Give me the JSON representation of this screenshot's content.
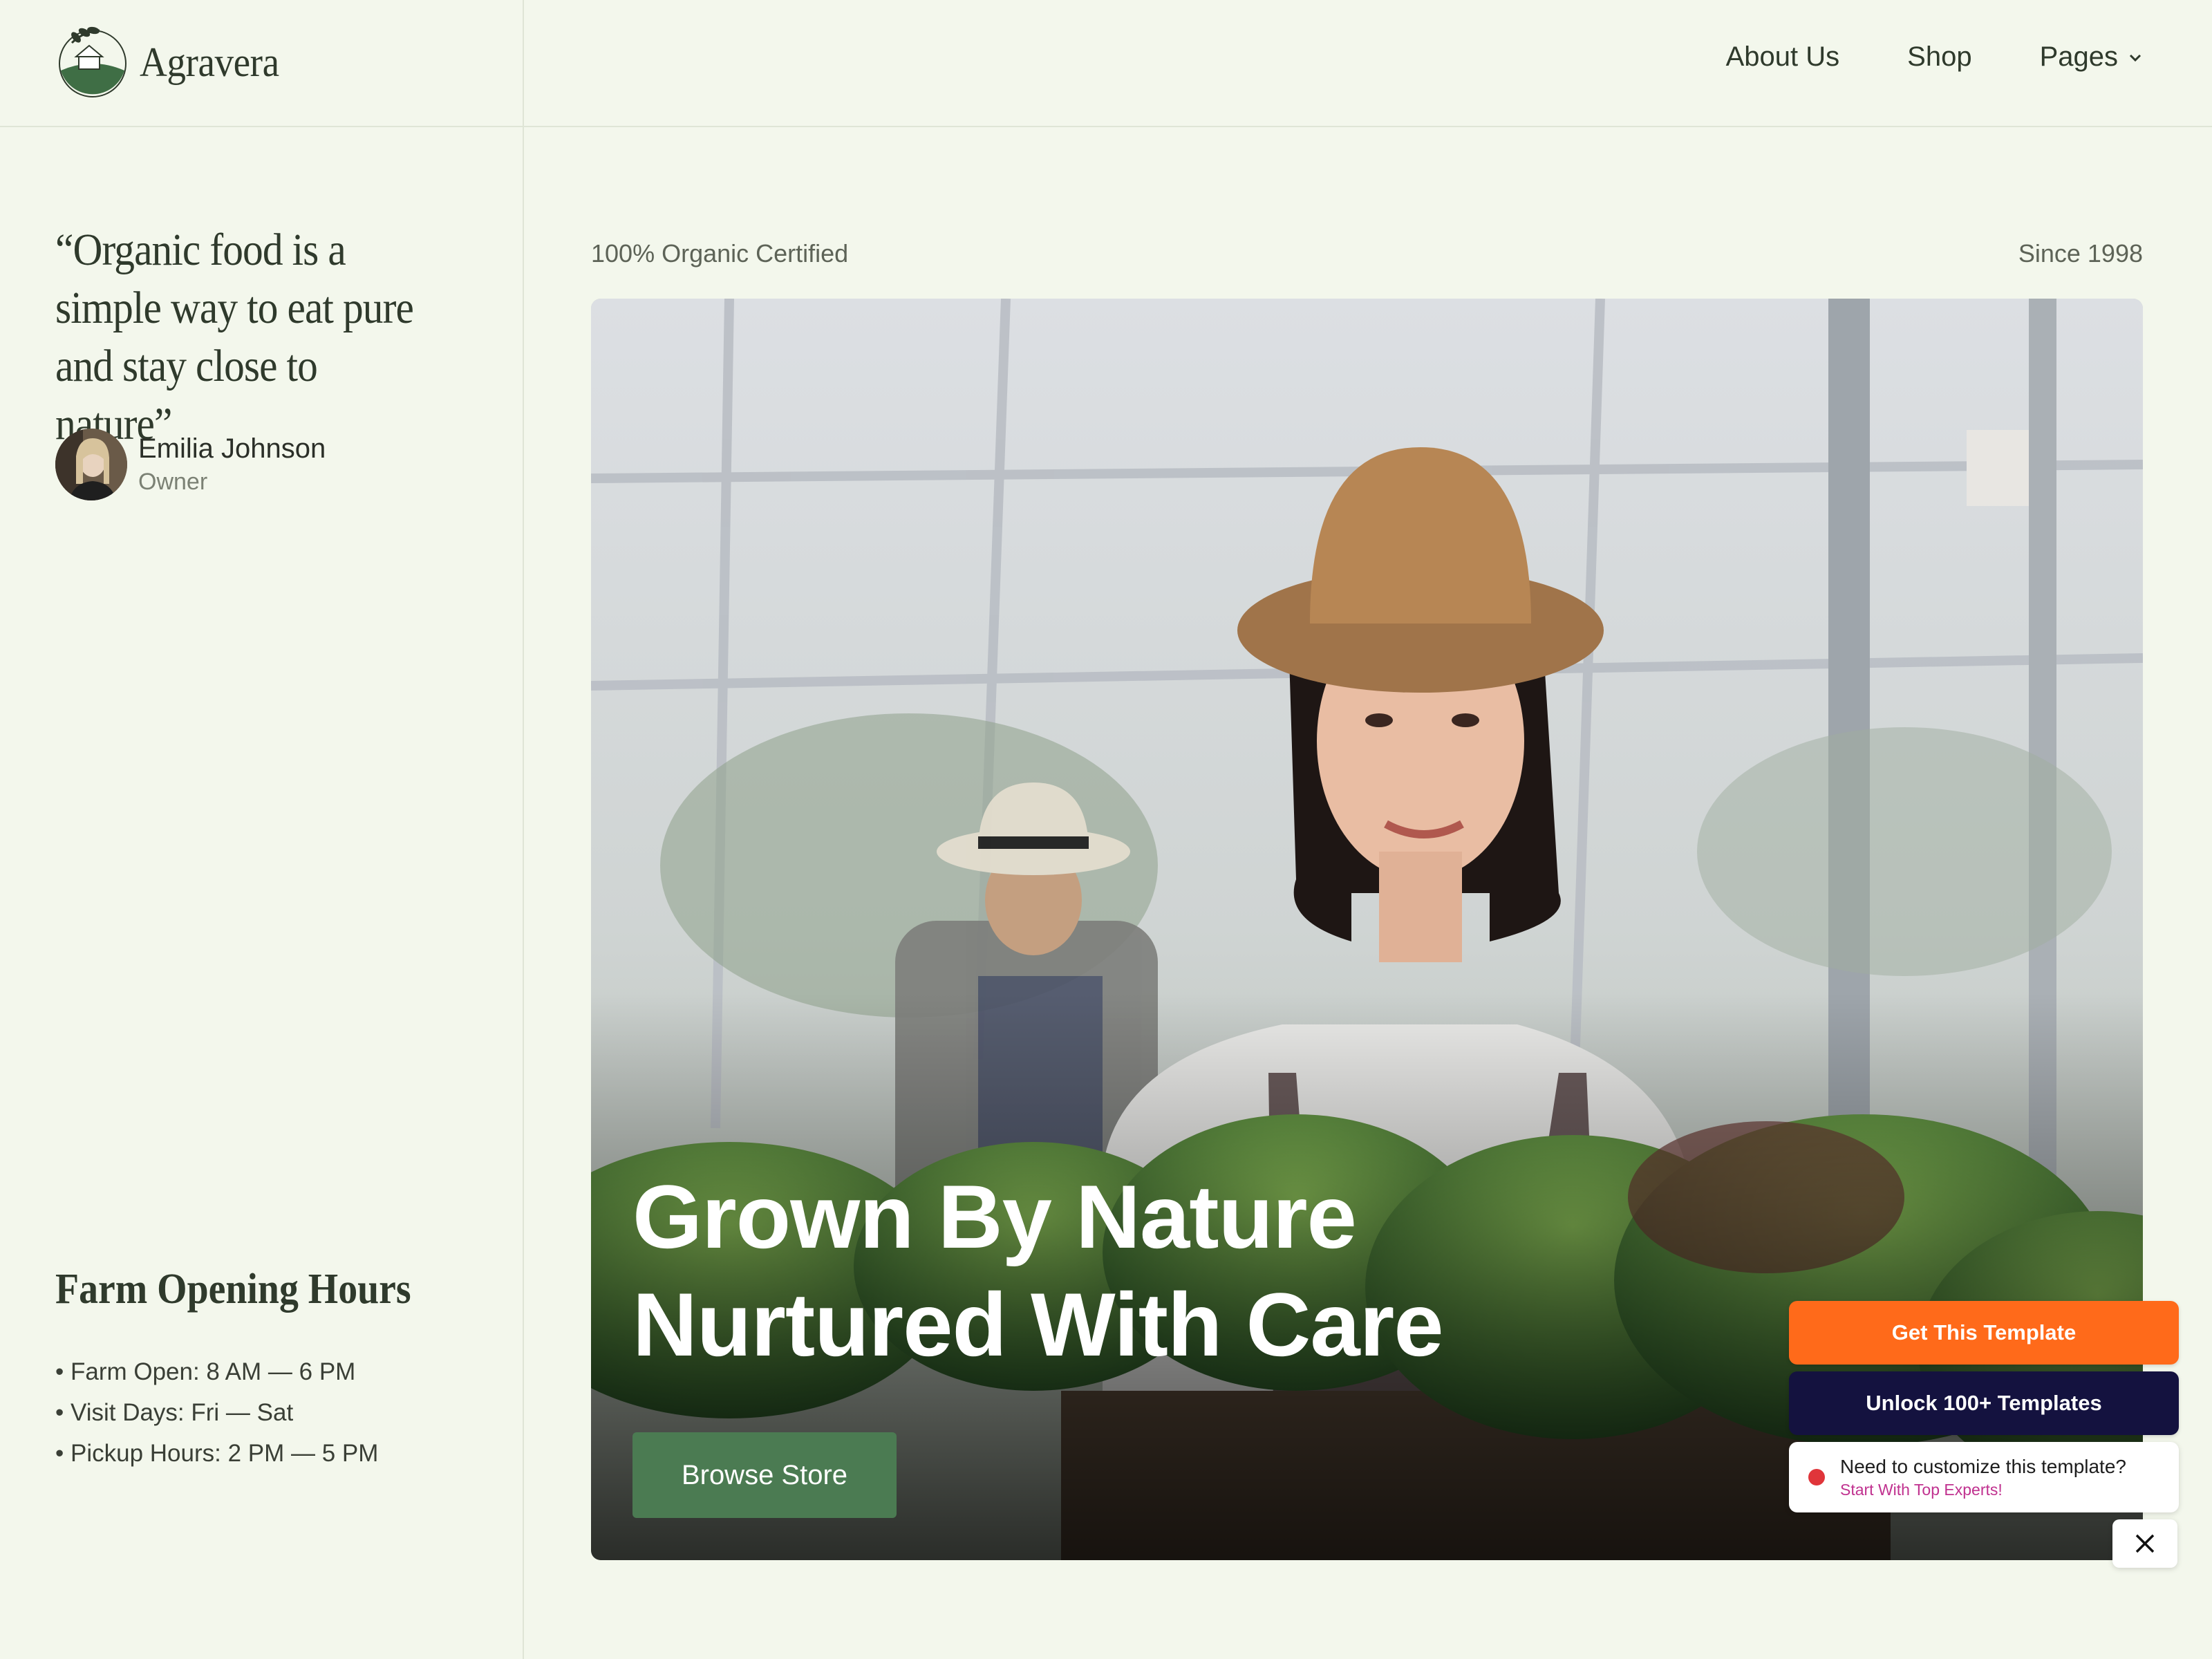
{
  "brand": {
    "name": "Agravera"
  },
  "nav": {
    "items": [
      {
        "label": "About Us"
      },
      {
        "label": "Shop"
      },
      {
        "label": "Pages"
      }
    ]
  },
  "testimonial": {
    "quote": "“Organic food is a simple way to eat pure and stay close to nature”",
    "author_name": "Emilia Johnson",
    "author_role": "Owner"
  },
  "hours": {
    "title": "Farm Opening Hours",
    "items": [
      "• Farm Open: 8 AM — 6 PM",
      "• Visit Days: Fri — Sat",
      "• Pickup Hours: 2 PM — 5 PM"
    ]
  },
  "hero": {
    "tag_left": "100% Organic Certified",
    "tag_right": "Since 1998",
    "title_line1": "Grown By Nature",
    "title_line2": "Nurtured With Care",
    "cta_label": "Browse Store"
  },
  "promo": {
    "get_template": "Get This Template",
    "unlock": "Unlock 100+ Templates",
    "customize_title": "Need to customize this template?",
    "customize_sub": "Start With Top Experts!"
  },
  "colors": {
    "background": "#f3f7ec",
    "brand_green": "#4b7b52",
    "orange": "#ff6a1a",
    "navy": "#14123f",
    "text_dark": "#2f3a2c"
  },
  "icons": {
    "logo": "leaf-farm-logo-icon",
    "pages_dropdown": "chevron-down-icon",
    "close": "close-icon",
    "status": "red-dot-icon"
  }
}
